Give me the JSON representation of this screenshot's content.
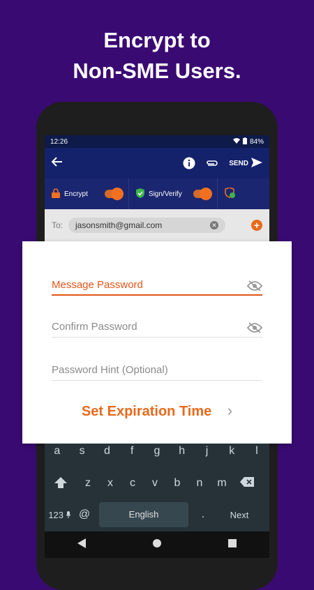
{
  "headline": {
    "line1": "Encrypt to",
    "line2": "Non-SME Users."
  },
  "status": {
    "time": "12:26",
    "battery": "84%"
  },
  "appbar": {
    "send_label": "SEND"
  },
  "toggles": {
    "encrypt_label": "Encrypt",
    "sign_label": "Sign/Verify"
  },
  "compose": {
    "to_label": "To:",
    "recipient": "jasonsmith@gmail.com"
  },
  "dialog": {
    "message_password": "Message Password",
    "confirm_password": "Confirm Password",
    "password_hint": "Password Hint (Optional)",
    "set_expiration": "Set Expiration Time"
  },
  "keyboard": {
    "row1": [
      "a",
      "s",
      "d",
      "f",
      "g",
      "h",
      "j",
      "k",
      "l"
    ],
    "row2": [
      "z",
      "x",
      "c",
      "v",
      "b",
      "n",
      "m"
    ],
    "numbers_key": "123",
    "at_key": "@",
    "space_label": "English",
    "period_key": ".",
    "next_key": "Next"
  },
  "colors": {
    "brand": "#3a0a73",
    "accent": "#e86a1c",
    "appbar": "#14216b"
  }
}
